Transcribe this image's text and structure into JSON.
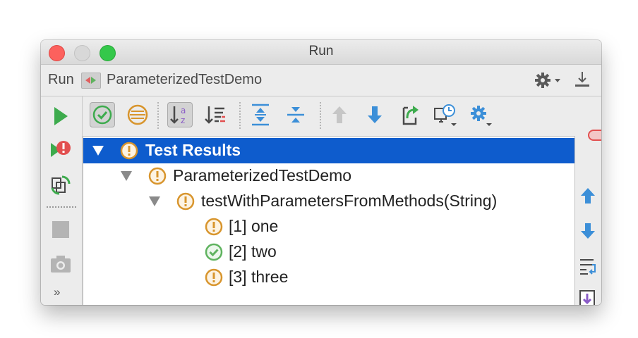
{
  "window": {
    "title": "Run"
  },
  "header": {
    "panel_label": "Run",
    "config_name": "ParameterizedTestDemo",
    "settings_icon": "gear-icon",
    "hide_icon": "minimize-icon"
  },
  "left_toolbar": {
    "items": [
      "rerun-icon",
      "rerun-failed-icon",
      "toggle-auto-test-icon",
      "stop-icon",
      "camera-icon"
    ],
    "more_label": "»"
  },
  "test_toolbar": {
    "items": [
      "show-passed-icon",
      "show-ignored-icon",
      "sort-alphabetically-icon",
      "sort-by-duration-icon",
      "expand-all-icon",
      "collapse-all-icon",
      "previous-failed-icon",
      "next-failed-icon",
      "export-results-icon",
      "test-history-icon",
      "test-settings-icon"
    ]
  },
  "tree": {
    "rows": [
      {
        "label": "Test Results",
        "status": "ignored",
        "expanded": true
      },
      {
        "label": "ParameterizedTestDemo",
        "status": "ignored",
        "expanded": true
      },
      {
        "label": "testWithParametersFromMethods(String)",
        "status": "ignored",
        "expanded": true
      },
      {
        "label": "[1] one",
        "status": "ignored"
      },
      {
        "label": "[2] two",
        "status": "passed"
      },
      {
        "label": "[3] three",
        "status": "ignored"
      }
    ]
  },
  "right_toolbar": {
    "items": [
      "up-arrow-icon",
      "down-arrow-icon",
      "soft-wrap-icon",
      "scroll-to-end-icon"
    ],
    "more_label": "»"
  },
  "colors": {
    "selection": "#0e5ccd",
    "ignored": "#d8952d",
    "passed": "#5fb35f",
    "run_green": "#3dab4d",
    "stop_red": "#e25050",
    "arrow_blue": "#3c8fd8"
  }
}
